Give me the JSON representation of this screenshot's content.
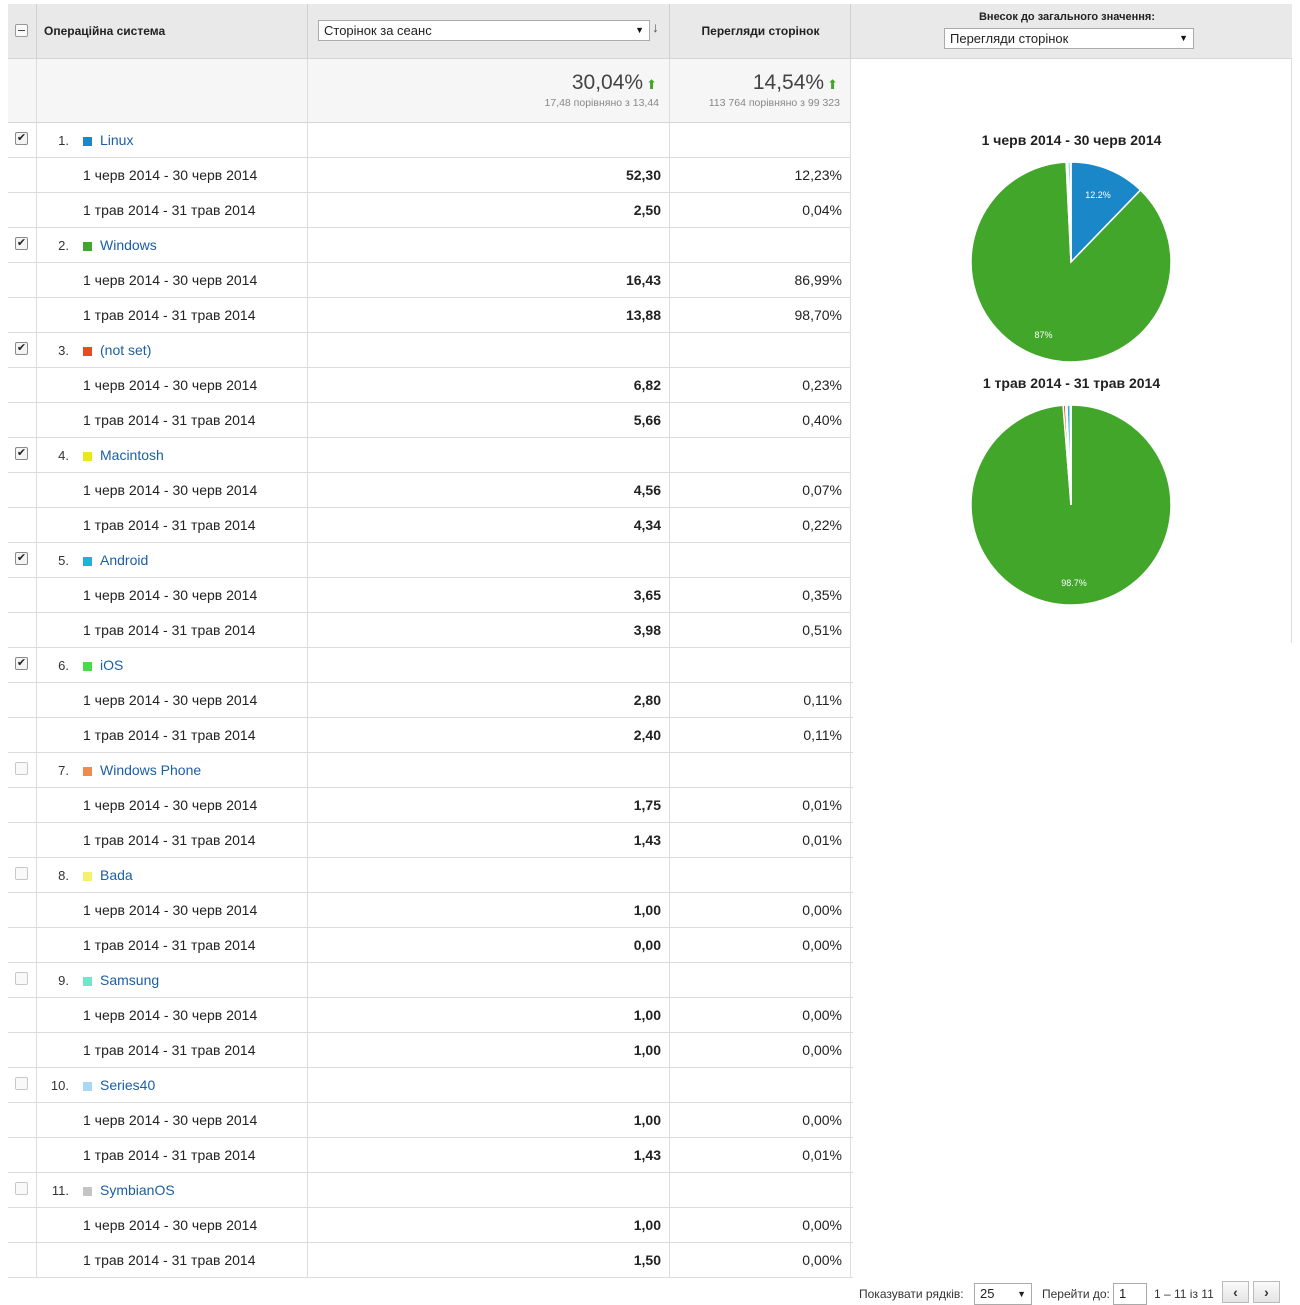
{
  "header": {
    "os_column": "Операційна система",
    "metric1_select": "Сторінок за сеанс",
    "metric2_label": "Перегляди сторінок",
    "contribution_label": "Внесок до загального значення:",
    "contribution_select": "Перегляди сторінок"
  },
  "totals": {
    "m1_big": "30,04%",
    "m1_small": "17,48 порівняно з 13,44",
    "m2_big": "14,54%",
    "m2_small": "113 764 порівняно з 99 323"
  },
  "rows": [
    {
      "num": "1.",
      "name": "Linux",
      "color": "#1a87c8",
      "checked": true,
      "r1": {
        "range": "1 черв 2014 - 30 черв 2014",
        "v1": "52,30",
        "v2": "12,23%"
      },
      "r2": {
        "range": "1 трав 2014 - 31 трав 2014",
        "v1": "2,50",
        "v2": "0,04%"
      }
    },
    {
      "num": "2.",
      "name": "Windows",
      "color": "#41a62a",
      "checked": true,
      "r1": {
        "range": "1 черв 2014 - 30 черв 2014",
        "v1": "16,43",
        "v2": "86,99%"
      },
      "r2": {
        "range": "1 трав 2014 - 31 трав 2014",
        "v1": "13,88",
        "v2": "98,70%"
      }
    },
    {
      "num": "3.",
      "name": "(not set)",
      "color": "#e84c1c",
      "checked": true,
      "r1": {
        "range": "1 черв 2014 - 30 черв 2014",
        "v1": "6,82",
        "v2": "0,23%"
      },
      "r2": {
        "range": "1 трав 2014 - 31 трав 2014",
        "v1": "5,66",
        "v2": "0,40%"
      }
    },
    {
      "num": "4.",
      "name": "Macintosh",
      "color": "#e8e81a",
      "checked": true,
      "r1": {
        "range": "1 черв 2014 - 30 черв 2014",
        "v1": "4,56",
        "v2": "0,07%"
      },
      "r2": {
        "range": "1 трав 2014 - 31 трав 2014",
        "v1": "4,34",
        "v2": "0,22%"
      }
    },
    {
      "num": "5.",
      "name": "Android",
      "color": "#1ab4d4",
      "checked": true,
      "r1": {
        "range": "1 черв 2014 - 30 черв 2014",
        "v1": "3,65",
        "v2": "0,35%"
      },
      "r2": {
        "range": "1 трав 2014 - 31 трав 2014",
        "v1": "3,98",
        "v2": "0,51%"
      }
    },
    {
      "num": "6.",
      "name": "iOS",
      "color": "#4cd94c",
      "checked": true,
      "r1": {
        "range": "1 черв 2014 - 30 черв 2014",
        "v1": "2,80",
        "v2": "0,11%"
      },
      "r2": {
        "range": "1 трав 2014 - 31 трав 2014",
        "v1": "2,40",
        "v2": "0,11%"
      }
    },
    {
      "num": "7.",
      "name": "Windows Phone",
      "color": "#f08a4c",
      "checked": false,
      "r1": {
        "range": "1 черв 2014 - 30 черв 2014",
        "v1": "1,75",
        "v2": "0,01%"
      },
      "r2": {
        "range": "1 трав 2014 - 31 трав 2014",
        "v1": "1,43",
        "v2": "0,01%"
      }
    },
    {
      "num": "8.",
      "name": "Bada",
      "color": "#f4f070",
      "checked": false,
      "r1": {
        "range": "1 черв 2014 - 30 черв 2014",
        "v1": "1,00",
        "v2": "0,00%"
      },
      "r2": {
        "range": "1 трав 2014 - 31 трав 2014",
        "v1": "0,00",
        "v2": "0,00%"
      }
    },
    {
      "num": "9.",
      "name": "Samsung",
      "color": "#6ee8c8",
      "checked": false,
      "r1": {
        "range": "1 черв 2014 - 30 черв 2014",
        "v1": "1,00",
        "v2": "0,00%"
      },
      "r2": {
        "range": "1 трав 2014 - 31 трав 2014",
        "v1": "1,00",
        "v2": "0,00%"
      }
    },
    {
      "num": "10.",
      "name": "Series40",
      "color": "#a8d8f4",
      "checked": false,
      "r1": {
        "range": "1 черв 2014 - 30 черв 2014",
        "v1": "1,00",
        "v2": "0,00%"
      },
      "r2": {
        "range": "1 трав 2014 - 31 трав 2014",
        "v1": "1,43",
        "v2": "0,01%"
      }
    },
    {
      "num": "11.",
      "name": "SymbianOS",
      "color": "#c4c4c4",
      "checked": false,
      "r1": {
        "range": "1 черв 2014 - 30 черв 2014",
        "v1": "1,00",
        "v2": "0,00%"
      },
      "r2": {
        "range": "1 трав 2014 - 31 трав 2014",
        "v1": "1,50",
        "v2": "0,00%"
      }
    }
  ],
  "chart_data": [
    {
      "type": "pie",
      "title": "1 черв 2014 - 30 черв 2014",
      "slices": [
        {
          "name": "Linux",
          "value": 12.23,
          "color": "#1a87c8",
          "label": "12.2%"
        },
        {
          "name": "Windows",
          "value": 86.99,
          "color": "#41a62a",
          "label": "87%"
        },
        {
          "name": "(not set)",
          "value": 0.23,
          "color": "#e84c1c"
        },
        {
          "name": "Macintosh",
          "value": 0.07,
          "color": "#e8e81a"
        },
        {
          "name": "Android",
          "value": 0.35,
          "color": "#1ab4d4"
        },
        {
          "name": "iOS",
          "value": 0.11,
          "color": "#4cd94c"
        },
        {
          "name": "Other",
          "value": 0.02,
          "color": "#c4c4c4"
        }
      ]
    },
    {
      "type": "pie",
      "title": "1 трав 2014 - 31 трав 2014",
      "slices": [
        {
          "name": "Linux",
          "value": 0.04,
          "color": "#1a87c8"
        },
        {
          "name": "Windows",
          "value": 98.7,
          "color": "#41a62a",
          "label": "98.7%"
        },
        {
          "name": "(not set)",
          "value": 0.4,
          "color": "#e84c1c"
        },
        {
          "name": "Macintosh",
          "value": 0.22,
          "color": "#e8e81a"
        },
        {
          "name": "Android",
          "value": 0.51,
          "color": "#1ab4d4"
        },
        {
          "name": "iOS",
          "value": 0.11,
          "color": "#4cd94c"
        },
        {
          "name": "Other",
          "value": 0.02,
          "color": "#c4c4c4"
        }
      ]
    }
  ],
  "footer": {
    "rows_label": "Показувати рядків:",
    "rows_value": "25",
    "goto_label": "Перейти до:",
    "goto_value": "1",
    "range_text": "1 – 11 із 11",
    "prev": "‹",
    "next": "›"
  }
}
